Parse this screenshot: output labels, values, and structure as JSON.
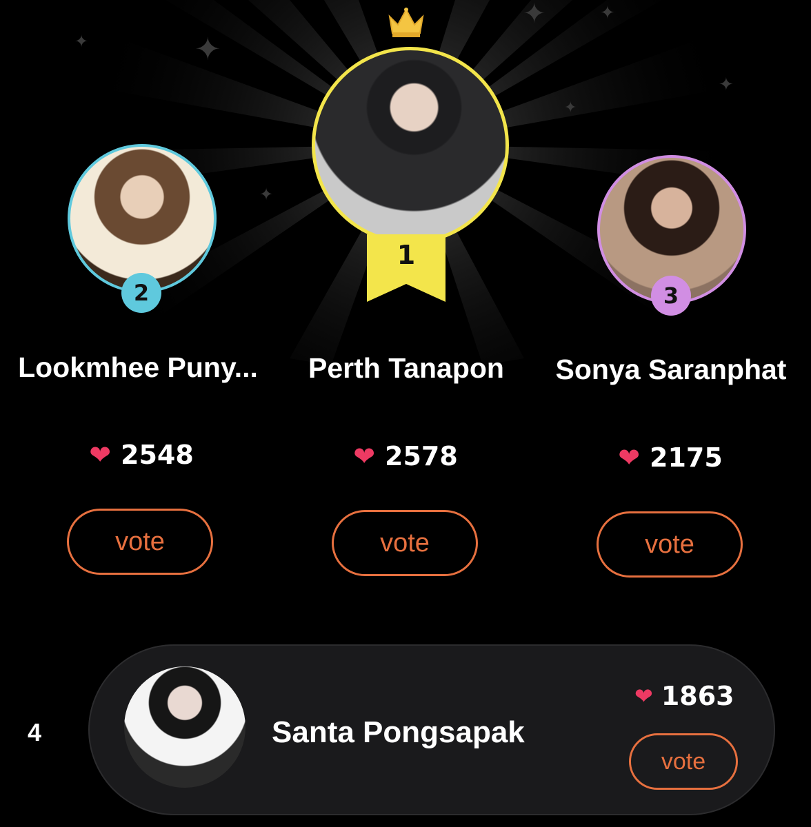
{
  "podium": [
    {
      "rank": "2",
      "name": "Lookmhee Puny...",
      "votes": "2548",
      "vote_label": "vote",
      "ring_color": "#5fc9dd"
    },
    {
      "rank": "1",
      "name": "Perth Tanapon",
      "votes": "2578",
      "vote_label": "vote",
      "ring_color": "#f3e54b"
    },
    {
      "rank": "3",
      "name": "Sonya Saranphat",
      "votes": "2175",
      "vote_label": "vote",
      "ring_color": "#d18ee3"
    }
  ],
  "list": [
    {
      "rank": "4",
      "name": "Santa Pongsapak",
      "votes": "1863",
      "vote_label": "vote"
    }
  ],
  "icons": {
    "heart": "heart-icon",
    "crown": "crown-icon",
    "ribbon": "ribbon-icon",
    "sparkle": "sparkle-icon"
  },
  "colors": {
    "accent": "#e7703f",
    "heart": "#ee3a63",
    "background": "#000000",
    "gold": "#f3e54b"
  }
}
